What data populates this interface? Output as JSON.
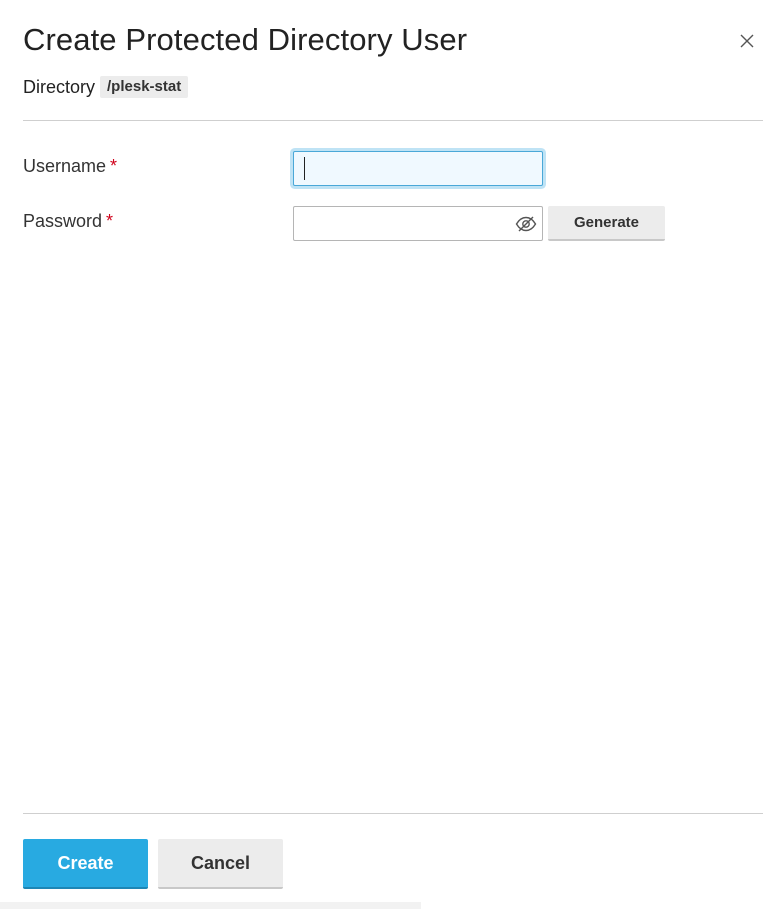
{
  "dialog": {
    "title": "Create Protected Directory User",
    "directory_label": "Directory",
    "directory_value": "/plesk-stat"
  },
  "form": {
    "username_label": "Username",
    "password_label": "Password",
    "required_marker": "*",
    "username_value": "",
    "password_value": "",
    "generate_label": "Generate"
  },
  "actions": {
    "create_label": "Create",
    "cancel_label": "Cancel"
  },
  "icons": {
    "close": "close-icon",
    "password_visibility": "eye-off-icon"
  },
  "colors": {
    "primary": "#28aae1",
    "required": "#d0021b",
    "focus_border": "#4aa8d8"
  }
}
